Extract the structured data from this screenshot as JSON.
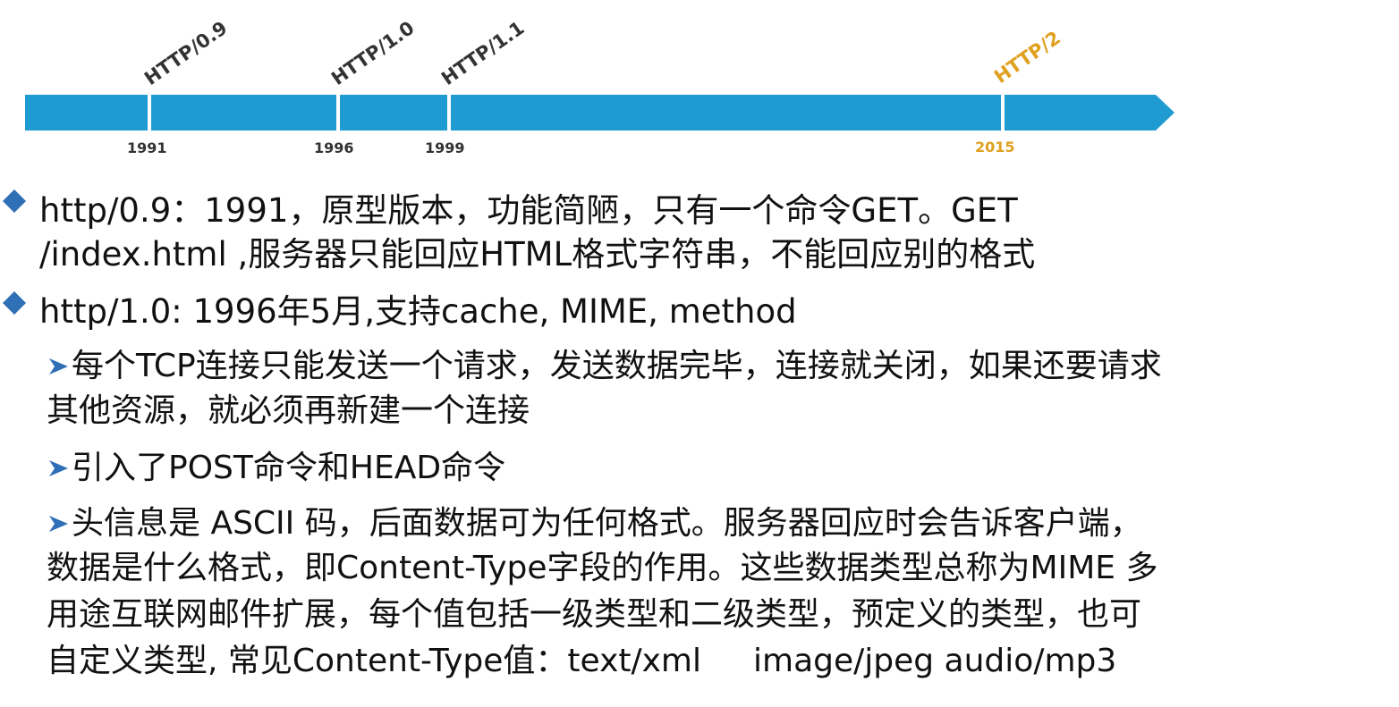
{
  "timeline": {
    "bar_color": "#1f9bd1",
    "milestones": [
      {
        "version": "HTTP/0.9",
        "year": "1991",
        "color": "#333333"
      },
      {
        "version": "HTTP/1.0",
        "year": "1996",
        "color": "#333333"
      },
      {
        "version": "HTTP/1.1",
        "year": "1999",
        "color": "#333333"
      },
      {
        "version": "HTTP/2",
        "year": "2015",
        "color": "#e0a020"
      }
    ]
  },
  "bullet_color": "#2e6fb5",
  "items": {
    "b1_line1": "http/0.9：1991，原型版本，功能简陋，只有一个命令GET。GET",
    "b1_line2": "/index.html ,服务器只能回应HTML格式字符串，不能回应别的格式",
    "b2_line1": "http/1.0: 1996年5月,支持cache, MIME, method",
    "s1_line1": "每个TCP连接只能发送一个请求，发送数据完毕，连接就关闭，如果还要请求",
    "s1_line2": "其他资源，就必须再新建一个连接",
    "s2_line1": "引入了POST命令和HEAD命令",
    "s3_line1": "头信息是 ASCII 码，后面数据可为任何格式。服务器回应时会告诉客户端，",
    "s3_line2": "数据是什么格式，即Content-Type字段的作用。这些数据类型总称为MIME 多",
    "s3_line3": "用途互联网邮件扩展，每个值包括一级类型和二级类型，预定义的类型，也可",
    "s3_line4a": "自定义类型, 常见Content-Type值：text/xml",
    "s3_line4b": "image/jpeg audio/mp3"
  }
}
